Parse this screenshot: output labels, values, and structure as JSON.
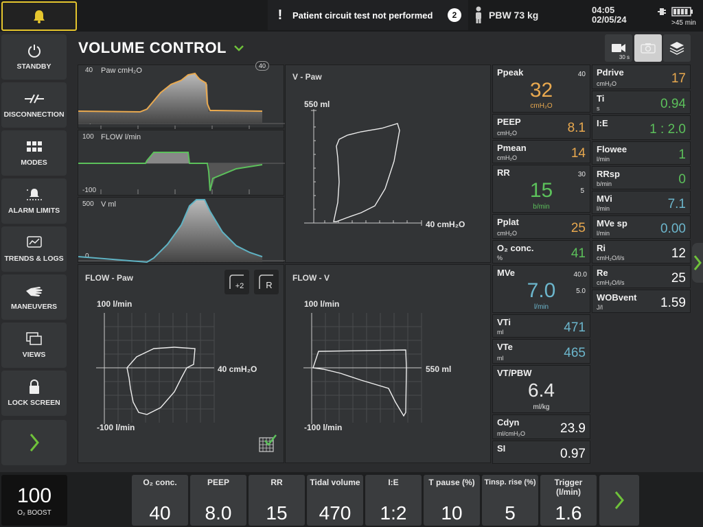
{
  "topbar": {
    "message_marker": "!",
    "message": "Patient circuit test not performed",
    "message_count": "2",
    "pbw": "PBW 73 kg",
    "time": "04:05",
    "date": "02/05/24",
    "battery_time": ">45 min"
  },
  "sidebar": [
    {
      "label": "STANDBY",
      "icon": "power-icon"
    },
    {
      "label": "DISCONNECTION",
      "icon": "disconnection-icon"
    },
    {
      "label": "MODES",
      "icon": "grid-icon"
    },
    {
      "label": "ALARM LIMITS",
      "icon": "alarm-limits-icon"
    },
    {
      "label": "TRENDS & LOGS",
      "icon": "trends-icon"
    },
    {
      "label": "MANEUVERS",
      "icon": "hand-icon"
    },
    {
      "label": "VIEWS",
      "icon": "views-icon"
    },
    {
      "label": "LOCK SCREEN",
      "icon": "lock-icon"
    }
  ],
  "mode": {
    "title": "VOLUME CONTROL"
  },
  "camera": {
    "timer": "30 s"
  },
  "waveforms": {
    "paw": {
      "label": "Paw cmH₂O",
      "max": "40",
      "min": "-4",
      "scale_badge": "40"
    },
    "flow": {
      "label": "FLOW l/min",
      "max": "100",
      "min": "-100"
    },
    "volume": {
      "label": "V ml",
      "max": "500",
      "min": "0"
    }
  },
  "loops": {
    "vpaw": {
      "title": "V - Paw",
      "ymax": "550 ml",
      "xmax": "40 cmH₂O"
    },
    "flowpaw": {
      "title": "FLOW - Paw",
      "ymax": "100 l/min",
      "ymin": "-100 l/min",
      "xmax": "40 cmH₂O",
      "btn1": "+2",
      "btn2": "R"
    },
    "flowv": {
      "title": "FLOW - V",
      "ymax": "100 l/min",
      "ymin": "-100 l/min",
      "xmax": "550 ml"
    }
  },
  "params": {
    "ppeak": {
      "name": "Ppeak",
      "value": "32",
      "unit": "cmH₂O",
      "hi": "40"
    },
    "peep": {
      "name": "PEEP",
      "unit": "cmH₂O",
      "value": "8.1"
    },
    "pmean": {
      "name": "Pmean",
      "unit": "cmH₂O",
      "value": "14"
    },
    "rr": {
      "name": "RR",
      "value": "15",
      "unit": "b/min",
      "hi": "30",
      "lo": "5"
    },
    "pplat": {
      "name": "Pplat",
      "unit": "cmH₂O",
      "value": "25"
    },
    "o2": {
      "name": "O₂ conc.",
      "unit": "%",
      "value": "41"
    },
    "mve": {
      "name": "MVe",
      "value": "7.0",
      "unit": "l/min",
      "hi": "40.0",
      "lo": "5.0"
    },
    "vti": {
      "name": "VTi",
      "unit": "ml",
      "value": "471"
    },
    "vte": {
      "name": "VTe",
      "unit": "ml",
      "value": "465"
    },
    "vtpbw": {
      "name": "VT/PBW",
      "value": "6.4",
      "unit": "ml/kg"
    },
    "cdyn": {
      "name": "Cdyn",
      "unit": "ml/cmH₂O",
      "value": "23.9"
    },
    "si": {
      "name": "SI",
      "value": "0.97"
    },
    "pdrive": {
      "name": "Pdrive",
      "unit": "cmH₂O",
      "value": "17"
    },
    "ti": {
      "name": "Ti",
      "unit": "s",
      "value": "0.94"
    },
    "ie": {
      "name": "I:E",
      "value": "1 : 2.0"
    },
    "flowee": {
      "name": "Flowee",
      "unit": "l/min",
      "value": "1"
    },
    "rrsp": {
      "name": "RRsp",
      "unit": "b/min",
      "value": "0"
    },
    "mvi": {
      "name": "MVi",
      "unit": "l/min",
      "value": "7.1"
    },
    "mvesp": {
      "name": "MVe sp",
      "unit": "l/min",
      "value": "0.00"
    },
    "ri": {
      "name": "Ri",
      "unit": "cmH₂O/l/s",
      "value": "12"
    },
    "re": {
      "name": "Re",
      "unit": "cmH₂O/l/s",
      "value": "25"
    },
    "wobvent": {
      "name": "WOBvent",
      "unit": "J/l",
      "value": "1.59"
    }
  },
  "bottom": {
    "boost": {
      "value": "100",
      "label": "O₂ BOOST"
    },
    "settings": [
      {
        "label": "O₂ conc.",
        "value": "40"
      },
      {
        "label": "PEEP",
        "value": "8.0"
      },
      {
        "label": "RR",
        "value": "15"
      },
      {
        "label": "Tidal volume",
        "value": "470"
      },
      {
        "label": "I:E",
        "value": "1:2"
      },
      {
        "label": "T pause (%)",
        "value": "10"
      },
      {
        "label": "Tinsp. rise (%)",
        "value": "5"
      },
      {
        "label": "Trigger (l/min)",
        "value": "1.6"
      }
    ]
  },
  "colors": {
    "accent_orange": "#e9a94f",
    "accent_green": "#5cc15b",
    "accent_blue": "#6cb6cc",
    "alarm_yellow": "#e6c62e"
  }
}
